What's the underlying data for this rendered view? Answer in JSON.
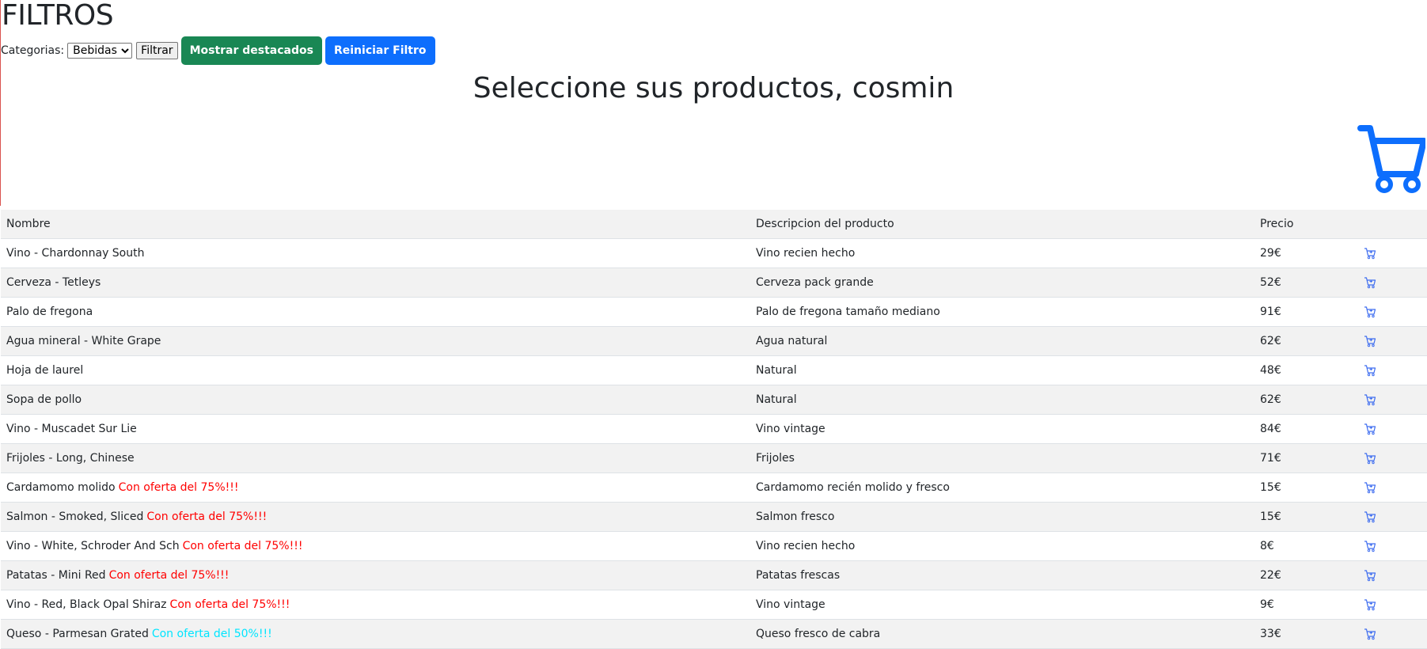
{
  "page": {
    "filters_title": "FILTROS",
    "greeting": "Seleccione sus productos, cosmin"
  },
  "filter_bar": {
    "category_label": "Categorias:",
    "category_selected": "Bebidas",
    "filter_button": "Filtrar",
    "featured_button": "Mostrar destacados",
    "reset_button": "Reiniciar Filtro"
  },
  "colors": {
    "accent_blue": "#0d6efd",
    "accent_green": "#198754",
    "offer_red": "#ff0000",
    "offer_cyan": "#00e5ff",
    "row_stripe": "#f2f2f2"
  },
  "icons": {
    "big_cart": "shopping-cart-icon",
    "row_cart": "add-to-cart-icon"
  },
  "table": {
    "headers": {
      "name": "Nombre",
      "description": "Descripcion del producto",
      "price": "Precio"
    },
    "rows": [
      {
        "name": "Vino - Chardonnay South",
        "offer": "",
        "offer_color": "",
        "description": "Vino recien hecho",
        "price": "29€"
      },
      {
        "name": "Cerveza - Tetleys",
        "offer": "",
        "offer_color": "",
        "description": "Cerveza pack grande",
        "price": "52€"
      },
      {
        "name": "Palo de fregona",
        "offer": "",
        "offer_color": "",
        "description": "Palo de fregona tamaño mediano",
        "price": "91€"
      },
      {
        "name": "Agua mineral - White Grape",
        "offer": "",
        "offer_color": "",
        "description": "Agua natural",
        "price": "62€"
      },
      {
        "name": "Hoja de laurel",
        "offer": "",
        "offer_color": "",
        "description": "Natural",
        "price": "48€"
      },
      {
        "name": "Sopa de pollo",
        "offer": "",
        "offer_color": "",
        "description": "Natural",
        "price": "62€"
      },
      {
        "name": "Vino - Muscadet Sur Lie",
        "offer": "",
        "offer_color": "",
        "description": "Vino vintage",
        "price": "84€"
      },
      {
        "name": "Frijoles - Long, Chinese",
        "offer": "",
        "offer_color": "",
        "description": "Frijoles",
        "price": "71€"
      },
      {
        "name": "Cardamomo molido",
        "offer": "Con oferta del 75%!!!",
        "offer_color": "red",
        "description": "Cardamomo recién molido y fresco",
        "price": "15€"
      },
      {
        "name": "Salmon - Smoked, Sliced",
        "offer": "Con oferta del 75%!!!",
        "offer_color": "red",
        "description": "Salmon fresco",
        "price": "15€"
      },
      {
        "name": "Vino - White, Schroder And Sch",
        "offer": "Con oferta del 75%!!!",
        "offer_color": "red",
        "description": "Vino recien hecho",
        "price": "8€"
      },
      {
        "name": "Patatas - Mini Red",
        "offer": "Con oferta del 75%!!!",
        "offer_color": "red",
        "description": "Patatas frescas",
        "price": "22€"
      },
      {
        "name": "Vino - Red, Black Opal Shiraz",
        "offer": "Con oferta del 75%!!!",
        "offer_color": "red",
        "description": "Vino vintage",
        "price": "9€"
      },
      {
        "name": "Queso - Parmesan Grated",
        "offer": "Con oferta del 50%!!!",
        "offer_color": "cyan",
        "description": "Queso fresco de cabra",
        "price": "33€"
      }
    ]
  }
}
